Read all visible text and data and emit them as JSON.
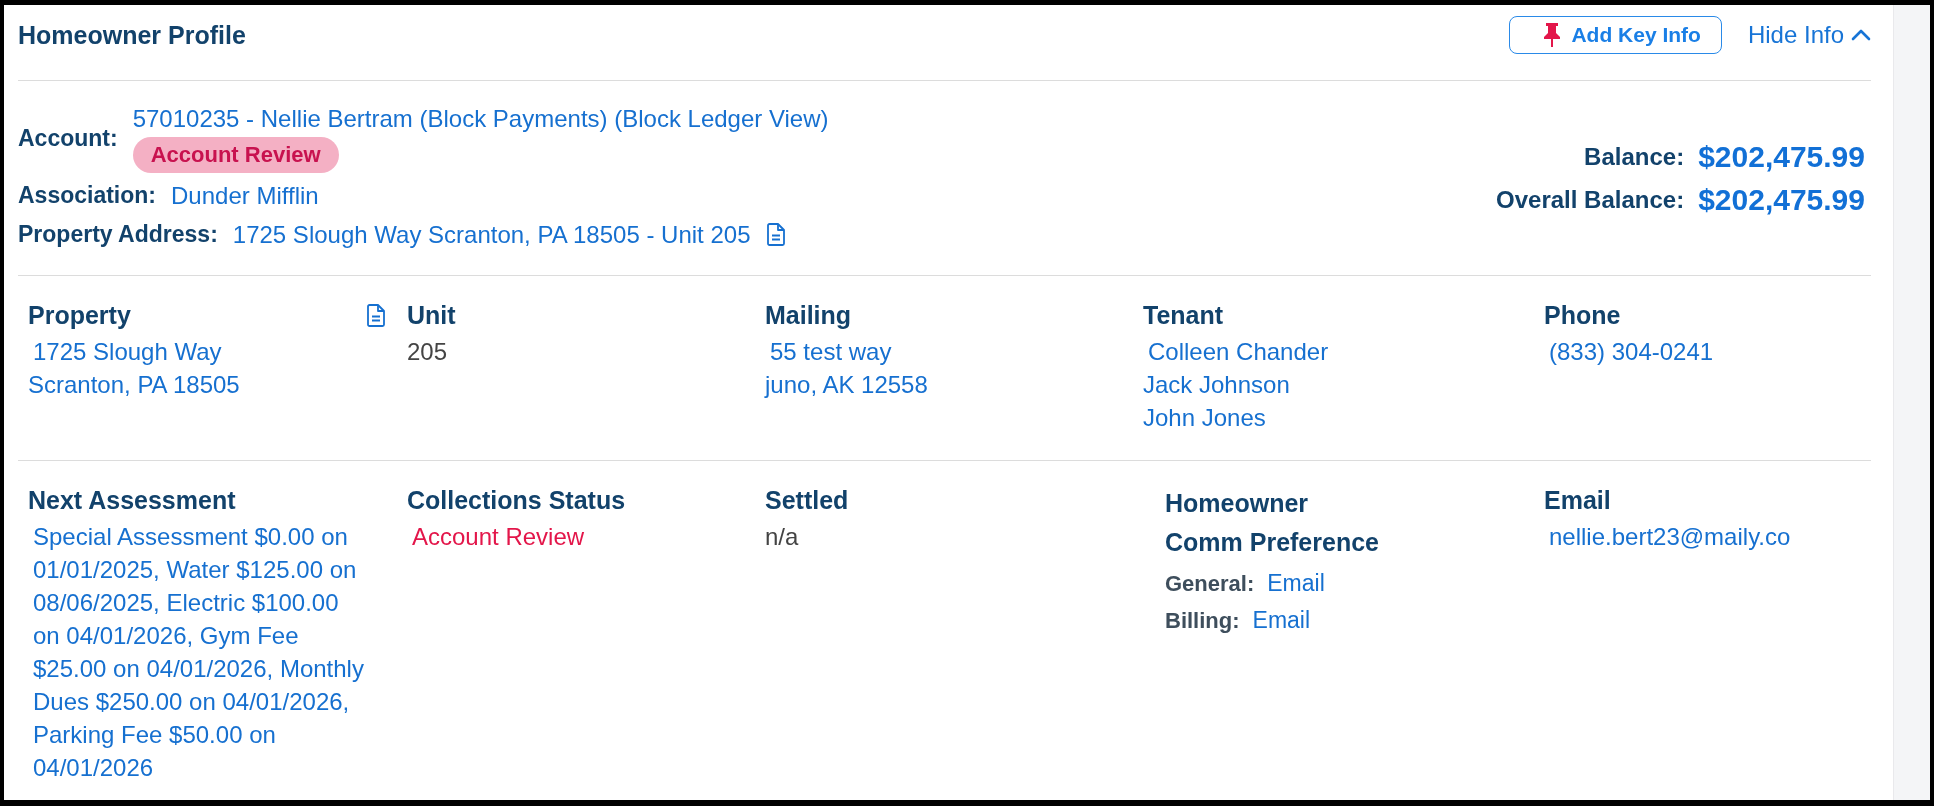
{
  "header": {
    "title": "Homeowner Profile",
    "add_button": "Add Key Info",
    "toggle": {
      "label": "Hide Info",
      "expanded": true
    }
  },
  "summary": {
    "fields": [
      {
        "label": "Account:",
        "kind": "account",
        "value": "57010235 - Nellie Bertram (Block Payments) (Block Ledger View)",
        "badge": "Account Review"
      },
      {
        "label": "Association:",
        "kind": "link",
        "value": "Dunder Mifflin"
      },
      {
        "label": "Property Address:",
        "kind": "document",
        "value": "1725 Slough Way Scranton, PA 18505 - Unit 205"
      }
    ],
    "balances": [
      {
        "label": "Balance:",
        "amount": "$202,475.99"
      },
      {
        "label": "Overall Balance:",
        "amount": "$202,475.99"
      }
    ]
  },
  "detail_rows": [
    [
      {
        "title": "Property",
        "kind": "document",
        "lines": [
          "1725 Slough Way",
          "Scranton, PA 18505"
        ]
      },
      {
        "title": "Unit",
        "kind": "text",
        "lines": [
          "205"
        ]
      },
      {
        "title": "Mailing",
        "kind": "links",
        "lines": [
          "55 test way",
          "juno, AK 12558"
        ]
      },
      {
        "title": "Tenant",
        "kind": "links",
        "lines": [
          "Colleen Chander",
          "Jack Johnson",
          "John Jones"
        ]
      },
      {
        "title": "Phone",
        "kind": "links",
        "lines": [
          "(833) 304-0241"
        ]
      }
    ],
    [
      {
        "title": "Next Assessment",
        "kind": "paragraph",
        "text": "Special Assessment $0.00 on 01/01/2025, Water $125.00 on 08/06/2025, Electric $100.00 on 04/01/2026, Gym Fee $25.00 on 04/01/2026, Monthly Dues $250.00 on 04/01/2026, Parking Fee $50.00 on 04/01/2026"
      },
      {
        "title": "Collections Status",
        "kind": "status",
        "lines": [
          "Account Review"
        ]
      },
      {
        "title": "Settled",
        "kind": "text",
        "lines": [
          "n/a"
        ]
      },
      {
        "title": "Homeowner Comm Preference",
        "kind": "preferences",
        "pairs": [
          {
            "label": "General:",
            "value": "Email"
          },
          {
            "label": "Billing:",
            "value": "Email"
          }
        ]
      },
      {
        "title": "Email",
        "kind": "links",
        "lines": [
          "nellie.bert23@maily.co"
        ]
      }
    ]
  ]
}
